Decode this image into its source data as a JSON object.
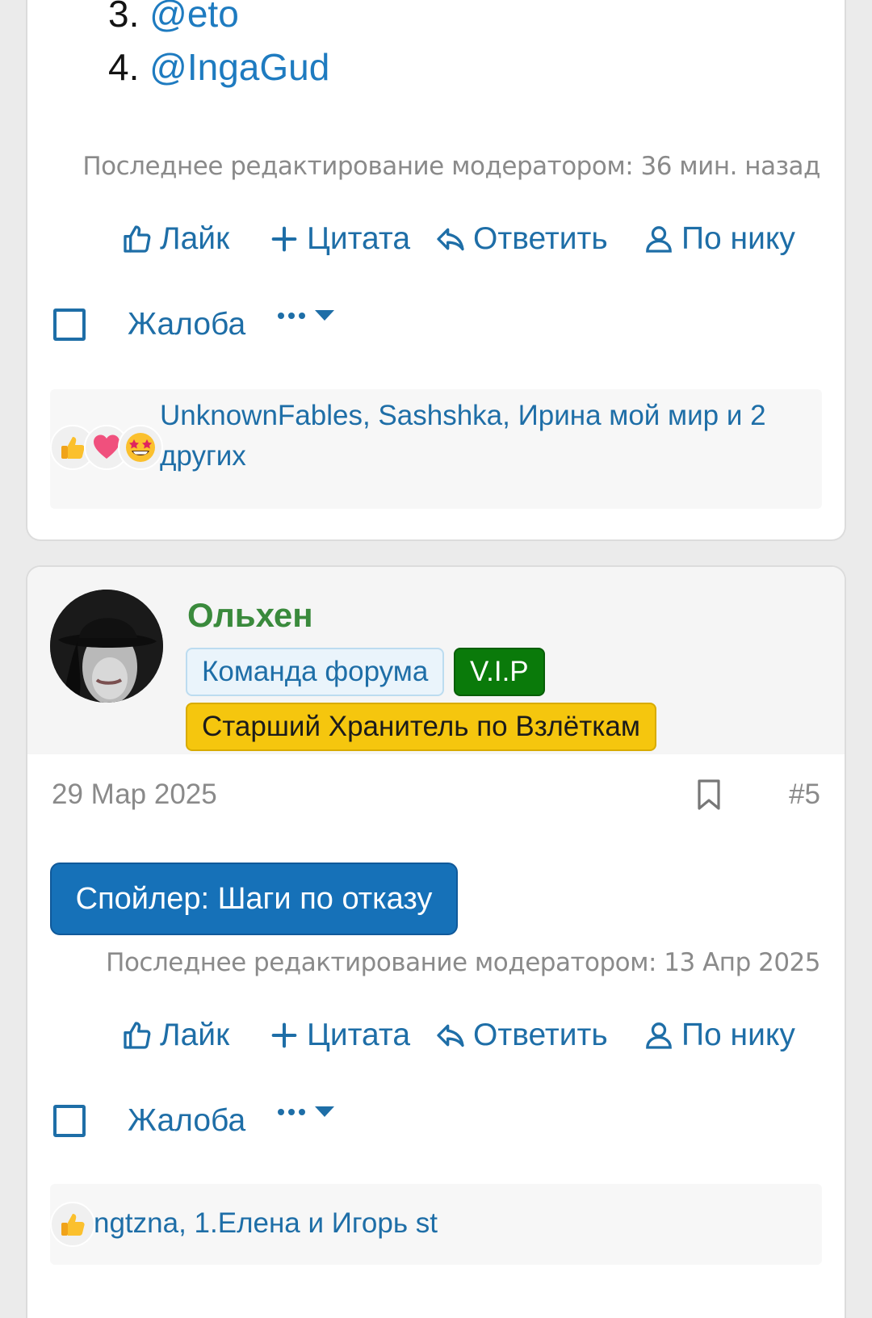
{
  "post1": {
    "list_items": [
      {
        "number": "3.",
        "mention": "@eto"
      },
      {
        "number": "4.",
        "mention": "@IngaGud"
      }
    ],
    "edit_note": "Последнее редактирование модератором: 36 мин. назад",
    "actions": {
      "like": "Лайк",
      "quote": "Цитата",
      "reply": "Ответить",
      "by_nick": "По нику"
    },
    "report": "Жалоба",
    "reactions": {
      "icons": [
        "thumbs-up-emoji",
        "heart-emoji",
        "star-struck-emoji"
      ],
      "text": "UnknownFables, Sashshka, Ирина мой мир и 2 других"
    }
  },
  "post2": {
    "username": "Ольхен",
    "badges": {
      "team": "Команда форума",
      "vip": "V.I.P",
      "keeper": "Старший Хранитель по Взлёткам"
    },
    "date": "29 Мар 2025",
    "post_number": "#5",
    "spoiler_label": "Спойлер: Шаги по отказу",
    "edit_note": "Последнее редактирование модератором: 13 Апр 2025",
    "actions": {
      "like": "Лайк",
      "quote": "Цитата",
      "reply": "Ответить",
      "by_nick": "По нику"
    },
    "report": "Жалоба",
    "reactions": {
      "icons": [
        "thumbs-up-emoji"
      ],
      "text": "ngtzna, 1.Елена и Игорь st"
    }
  },
  "colors": {
    "link": "#1e6ea7",
    "username": "#3a8a3c",
    "vip_badge": "#0a7a0a",
    "keeper_badge": "#f5c60e",
    "spoiler_button": "#1671b8"
  }
}
